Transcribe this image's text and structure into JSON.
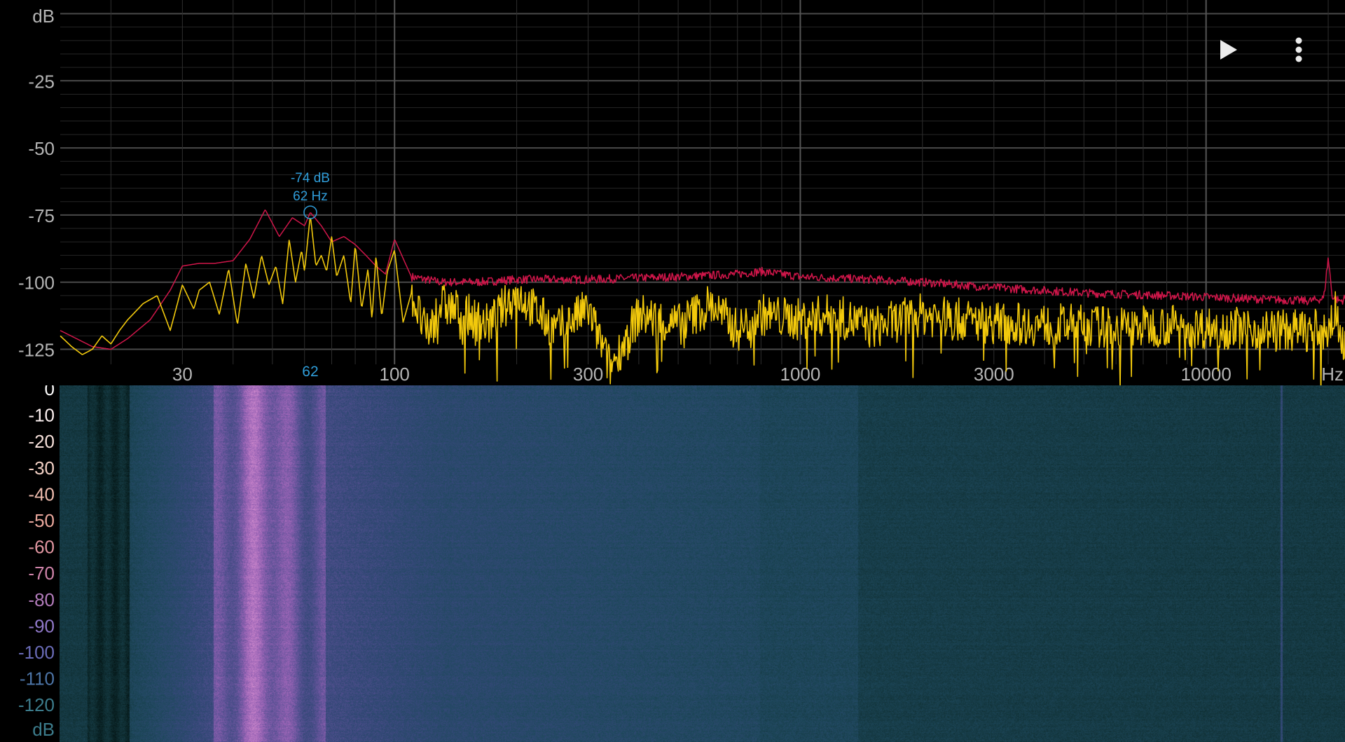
{
  "chart_data": [
    {
      "type": "line",
      "title": "",
      "xlabel": "Hz",
      "ylabel": "dB",
      "x_scale": "log",
      "xlim": [
        15,
        22000
      ],
      "ylim": [
        -128,
        3
      ],
      "y_ticks": [
        "-25",
        "-50",
        "-75",
        "-100",
        "-125"
      ],
      "x_ticks": [
        "30",
        "100",
        "300",
        "1000",
        "3000",
        "10000"
      ],
      "grid": true,
      "marker": {
        "freq": 62,
        "db": -74,
        "db_label": "-74 dB",
        "hz_label": "62 Hz",
        "axis_label": "62"
      },
      "series": [
        {
          "color": "#d0164a",
          "x": [
            15,
            18,
            20,
            22,
            25,
            28,
            30,
            33,
            36,
            40,
            44,
            48,
            52,
            56,
            60,
            62,
            66,
            70,
            75,
            80,
            85,
            90,
            95,
            100,
            110,
            130,
            160,
            200,
            300,
            500,
            700,
            800,
            1000,
            1500,
            2000,
            3000,
            5000,
            8000,
            12000,
            18000,
            19500,
            20000,
            20500,
            21500,
            22000
          ],
          "y": [
            -118,
            -124,
            -125,
            -121,
            -114,
            -103,
            -94,
            -93,
            -93,
            -92,
            -84,
            -73,
            -83,
            -76,
            -79,
            -74,
            -79,
            -85,
            -83,
            -86,
            -90,
            -94,
            -97,
            -84,
            -98,
            -100,
            -100,
            -99,
            -99,
            -98,
            -97,
            -96,
            -98,
            -99,
            -100,
            -102,
            -104,
            -105,
            -106,
            -107,
            -106,
            -91,
            -106,
            -107,
            -106
          ]
        },
        {
          "color": "#f2c90c",
          "x": [
            15,
            16,
            17,
            18,
            19,
            20,
            21,
            22,
            24,
            26,
            28,
            30,
            32,
            33,
            35,
            37,
            39,
            41,
            43,
            45,
            47,
            49,
            51,
            53,
            55,
            57,
            59,
            60,
            62,
            64,
            66,
            68,
            70,
            72,
            75,
            78,
            80,
            83,
            86,
            88,
            90,
            93,
            96,
            100,
            105,
            110,
            120,
            130,
            150,
            170,
            200,
            250,
            300,
            340,
            400,
            500,
            600,
            700,
            800,
            1000,
            1200,
            1500,
            2000,
            2500,
            3000,
            4000,
            5000,
            6000,
            8000,
            10000,
            12000,
            15000,
            18000,
            20000,
            21000,
            22000
          ],
          "y": [
            -120,
            -124,
            -127,
            -125,
            -120,
            -123,
            -118,
            -114,
            -108,
            -105,
            -118,
            -101,
            -110,
            -103,
            -100,
            -112,
            -95,
            -116,
            -93,
            -106,
            -90,
            -101,
            -94,
            -108,
            -84,
            -100,
            -88,
            -96,
            -75,
            -94,
            -90,
            -96,
            -83,
            -98,
            -90,
            -108,
            -86,
            -110,
            -95,
            -114,
            -90,
            -113,
            -96,
            -88,
            -115,
            -104,
            -120,
            -108,
            -112,
            -116,
            -104,
            -118,
            -110,
            -132,
            -112,
            -116,
            -108,
            -118,
            -112,
            -114,
            -112,
            -117,
            -112,
            -114,
            -115,
            -116,
            -116,
            -117,
            -116,
            -117,
            -117,
            -118,
            -118,
            -118,
            -110,
            -126
          ]
        }
      ]
    },
    {
      "type": "heatmap",
      "ylabel": "dB",
      "y_ticks": [
        "0",
        "-10",
        "-20",
        "-30",
        "-40",
        "-50",
        "-60",
        "-70",
        "-80",
        "-90",
        "-100",
        "-110",
        "-120"
      ]
    }
  ],
  "controls": {
    "play_icon": "play-icon",
    "menu_icon": "more-vert-icon"
  }
}
